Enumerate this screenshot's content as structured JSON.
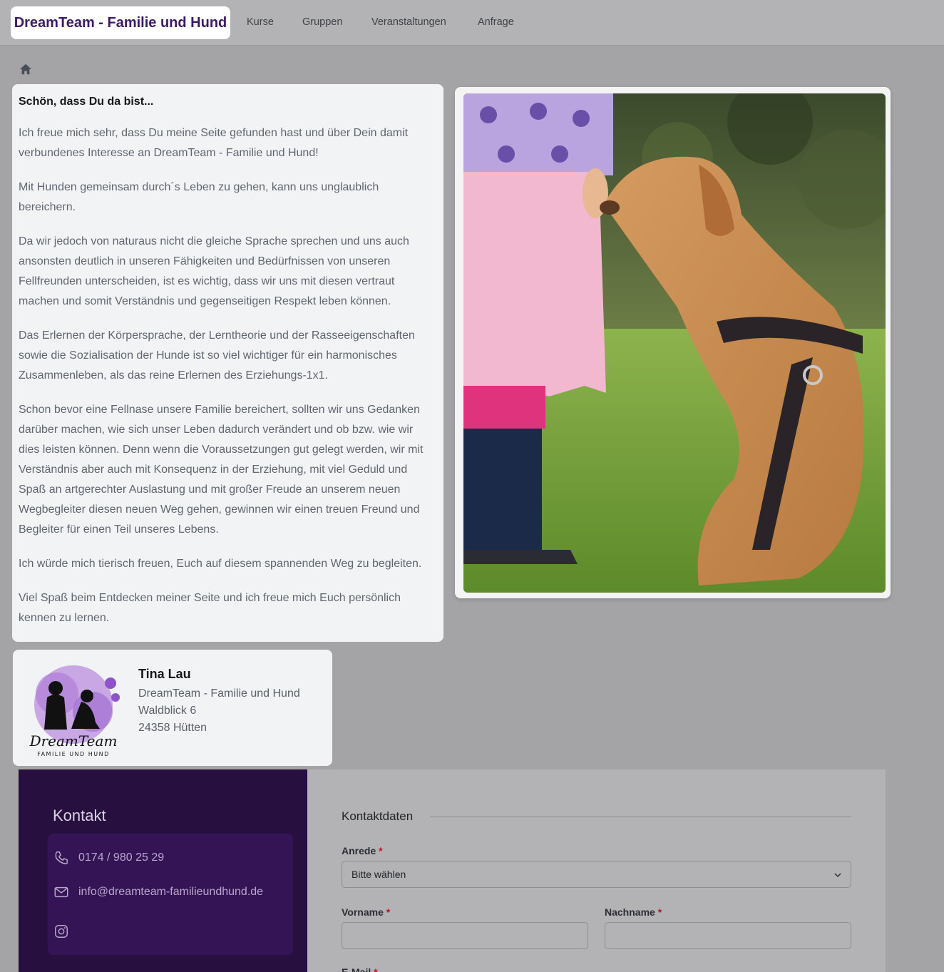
{
  "nav": {
    "brand": "DreamTeam - Familie und Hund",
    "links": [
      "Kurse",
      "Gruppen",
      "Veranstaltungen",
      "Anfrage"
    ]
  },
  "welcome": {
    "heading": "Schön, dass Du da bist...",
    "paragraphs": [
      "Ich freue mich sehr, dass Du meine Seite gefunden hast und über Dein damit verbundenes Interesse an DreamTeam - Familie und Hund!",
      "Mit Hunden gemeinsam durch´s Leben zu gehen, kann uns unglaublich bereichern.",
      "Da wir jedoch von naturaus nicht die gleiche Sprache sprechen und uns auch ansonsten deutlich in unseren Fähigkeiten und Bedürfnissen von unseren Fellfreunden unterscheiden, ist es wichtig, dass wir uns mit diesen vertraut machen und somit Verständnis und gegenseitigen Respekt leben können.",
      "Das Erlernen der Körpersprache, der Lerntheorie und der Rasseeigenschaften sowie die Sozialisation der Hunde ist so viel wichtiger für ein harmonisches Zusammenleben, als das reine Erlernen des Erziehungs-1x1.",
      "Schon bevor eine Fellnase unsere Familie bereichert, sollten wir uns Gedanken darüber machen, wie sich unser Leben dadurch verändert und ob bzw. wie wir dies leisten können. Denn wenn die Voraussetzungen gut gelegt werden, wir mit Verständnis aber auch mit Konsequenz in der Erziehung, mit viel Geduld und Spaß an artgerechter Auslastung und mit großer Freude an unserem neuen Wegbegleiter diesen neuen Weg gehen, gewinnen wir einen treuen Freund und Begleiter für einen Teil unseres Lebens.",
      "Ich würde mich tierisch freuen, Euch auf diesem spannenden Weg zu begleiten.",
      "Viel Spaß beim Entdecken meiner Seite und ich freue mich Euch persönlich kennen zu lernen."
    ]
  },
  "address": {
    "name": "Tina Lau",
    "company": "DreamTeam - Familie und Hund",
    "street": "Waldblick 6",
    "city": "24358 Hütten",
    "logo_text": "DreamTeam",
    "logo_subtext": "FAMILIE UND HUND"
  },
  "contact": {
    "title": "Kontakt",
    "phone": "0174 / 980 25 29",
    "email": "info@dreamteam-familieundhund.de",
    "icons": [
      "phone-icon",
      "mail-icon",
      "instagram-icon"
    ]
  },
  "form": {
    "section_title": "Kontaktdaten",
    "salutation_label": "Anrede",
    "salutation_value": "Bitte wählen",
    "firstname_label": "Vorname",
    "lastname_label": "Nachname",
    "email_label": "E-Mail",
    "required_mark": "*"
  },
  "colors": {
    "brand_purple": "#3b1a66",
    "contact_bg": "#271040",
    "contact_box": "#351456",
    "required": "#c1121f"
  }
}
